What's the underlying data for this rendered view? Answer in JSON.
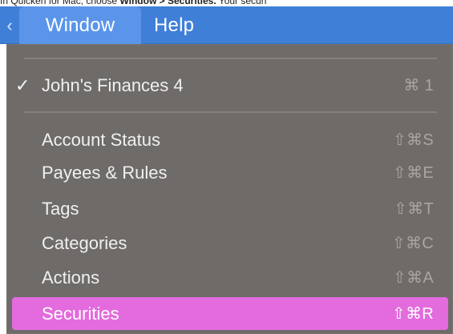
{
  "caption": {
    "prefix": "In Quicken for Mac, choose ",
    "bold_path": "Window > Securities.",
    "suffix": " Your securi"
  },
  "menubar": {
    "chevron_icon": "chevron-left-icon",
    "window_label": "Window",
    "help_label": "Help"
  },
  "menu": {
    "items": [
      {
        "label": "John's Finances 4",
        "checked": true,
        "check": "✓",
        "shortcut": "⌘ 1"
      },
      {
        "label": "Account Status",
        "shortcut": "⇧⌘S"
      },
      {
        "label": "Payees & Rules",
        "shortcut": "⇧⌘E"
      },
      {
        "label": "Tags",
        "shortcut": "⇧⌘T"
      },
      {
        "label": "Categories",
        "shortcut": "⇧⌘C"
      },
      {
        "label": "Actions",
        "shortcut": "⇧⌘A"
      },
      {
        "label": "Securities",
        "shortcut": "⇧⌘R",
        "selected": true
      }
    ]
  },
  "colors": {
    "menubar_bg": "#3f7fd8",
    "menubar_active": "#5a95ea",
    "menu_bg": "#6f6b69",
    "selected_bg": "#e36bdd"
  }
}
